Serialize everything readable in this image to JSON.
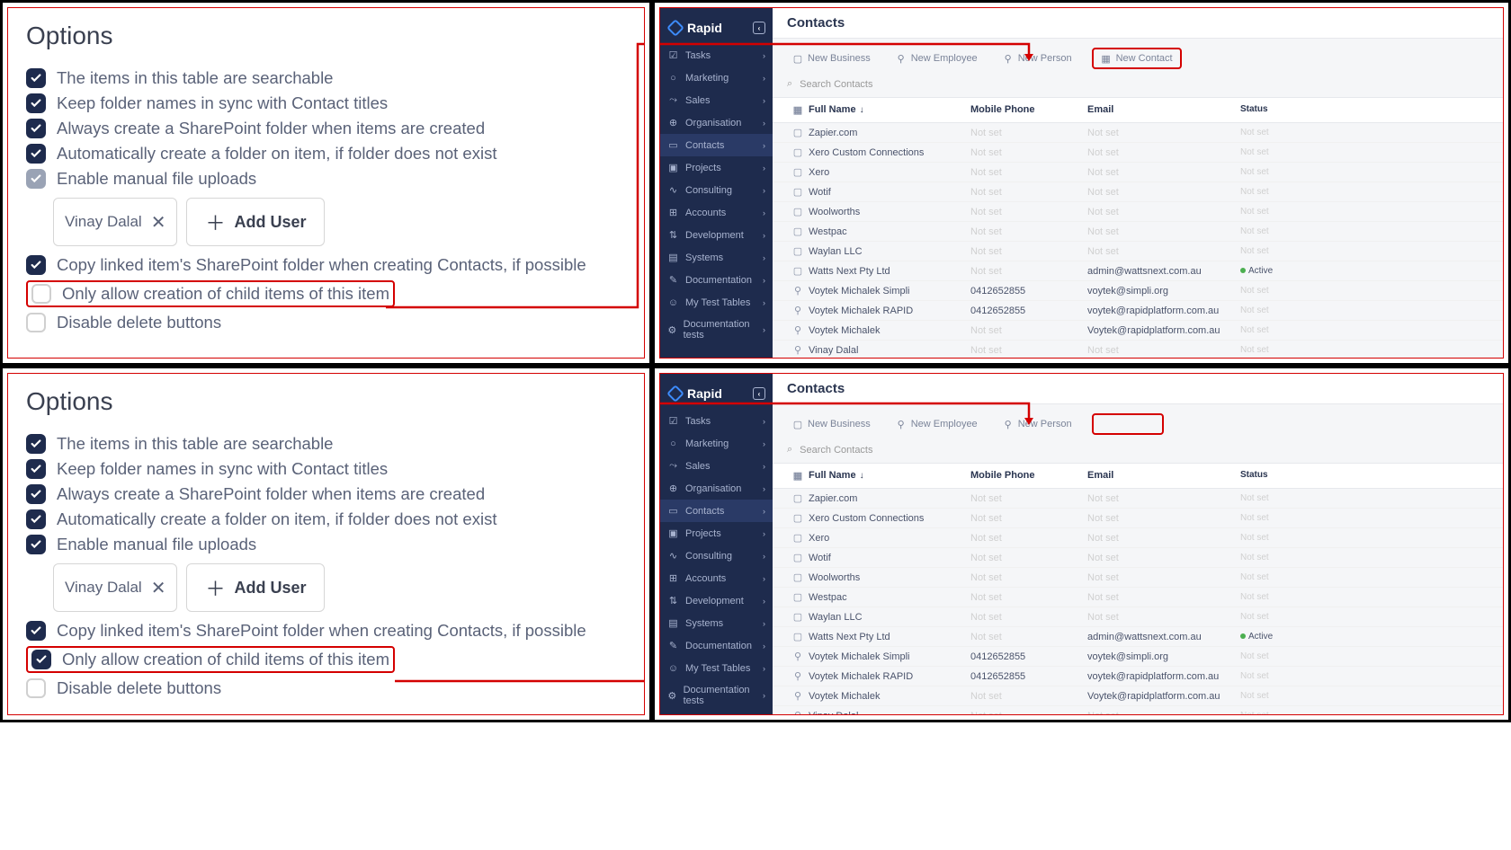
{
  "options_title": "Options",
  "opts": [
    {
      "label": "The items in this table are searchable"
    },
    {
      "label": "Keep folder names in sync with Contact titles"
    },
    {
      "label": "Always create a SharePoint folder when items are created"
    },
    {
      "label": "Automatically create a folder on item, if folder does not exist"
    },
    {
      "label": "Enable manual file uploads"
    },
    {
      "label": "Copy linked item's SharePoint folder when creating Contacts, if possible"
    },
    {
      "label": "Only allow creation of child items of this item"
    },
    {
      "label": "Disable delete buttons"
    }
  ],
  "chip_name": "Vinay Dalal",
  "add_user": "Add User",
  "brand": "Rapid",
  "nav": [
    {
      "label": "Tasks",
      "icon": "☑"
    },
    {
      "label": "Marketing",
      "icon": "○"
    },
    {
      "label": "Sales",
      "icon": "⤳"
    },
    {
      "label": "Organisation",
      "icon": "⊕"
    },
    {
      "label": "Contacts",
      "icon": "▭"
    },
    {
      "label": "Projects",
      "icon": "▣"
    },
    {
      "label": "Consulting",
      "icon": "∿"
    },
    {
      "label": "Accounts",
      "icon": "⊞"
    },
    {
      "label": "Development",
      "icon": "⇅"
    },
    {
      "label": "Systems",
      "icon": "▤"
    },
    {
      "label": "Documentation",
      "icon": "✎"
    },
    {
      "label": "My Test Tables",
      "icon": "☺"
    },
    {
      "label": "Documentation tests",
      "icon": "⚙"
    }
  ],
  "page_title": "Contacts",
  "tabs": [
    {
      "label": "New Business",
      "icon": "▢"
    },
    {
      "label": "New Employee",
      "icon": "⚲"
    },
    {
      "label": "New Person",
      "icon": "⚲"
    },
    {
      "label": "New Contact",
      "icon": "▦"
    }
  ],
  "search_placeholder": "Search Contacts",
  "cols": {
    "name": "Full Name",
    "mob": "Mobile Phone",
    "email": "Email",
    "status": "Status"
  },
  "rows": [
    {
      "icon": "▢",
      "name": "Zapier.com",
      "mob": "",
      "email": "",
      "status": ""
    },
    {
      "icon": "▢",
      "name": "Xero Custom Connections",
      "mob": "",
      "email": "",
      "status": ""
    },
    {
      "icon": "▢",
      "name": "Xero",
      "mob": "",
      "email": "",
      "status": ""
    },
    {
      "icon": "▢",
      "name": "Wotif",
      "mob": "",
      "email": "",
      "status": ""
    },
    {
      "icon": "▢",
      "name": "Woolworths",
      "mob": "",
      "email": "",
      "status": ""
    },
    {
      "icon": "▢",
      "name": "Westpac",
      "mob": "",
      "email": "",
      "status": ""
    },
    {
      "icon": "▢",
      "name": "Waylan LLC",
      "mob": "",
      "email": "",
      "status": ""
    },
    {
      "icon": "▢",
      "name": "Watts Next Pty Ltd",
      "mob": "",
      "email": "admin@wattsnext.com.au",
      "status": "Active"
    },
    {
      "icon": "⚲",
      "name": "Voytek Michalek Simpli",
      "mob": "0412652855",
      "email": "voytek@simpli.org",
      "status": ""
    },
    {
      "icon": "⚲",
      "name": "Voytek Michalek RAPID",
      "mob": "0412652855",
      "email": "voytek@rapidplatform.com.au",
      "status": ""
    },
    {
      "icon": "⚲",
      "name": "Voytek Michalek",
      "mob": "",
      "email": "Voytek@rapidplatform.com.au",
      "status": ""
    },
    {
      "icon": "⚲",
      "name": "Vinay Dalal",
      "mob": "",
      "email": "",
      "status": ""
    }
  ],
  "not_set": "Not set"
}
